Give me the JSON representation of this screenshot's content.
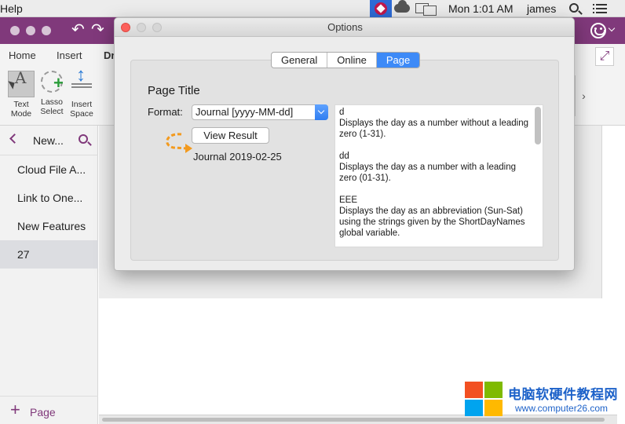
{
  "menubar": {
    "app_menu": "Help",
    "clock": "Mon 1:01 AM",
    "user": "james",
    "icons": [
      "gem-icon",
      "cloud-icon",
      "screen-mirroring-icon",
      "spotlight-icon",
      "list-icon"
    ]
  },
  "window": {
    "titlebar_color": "#80397b",
    "ribbon_tabs": [
      "Home",
      "Insert",
      "Dr"
    ],
    "tools": [
      {
        "label": "Text\nMode",
        "icon": "text-mode-icon"
      },
      {
        "label": "Lasso\nSelect",
        "icon": "lasso-select-icon"
      },
      {
        "label": "Insert\nSpace",
        "icon": "insert-space-icon"
      }
    ]
  },
  "nav": {
    "section_title": "New...",
    "pages": [
      "Cloud File A...",
      "Link to One...",
      "New Features",
      "27"
    ],
    "selected_index": 3,
    "add_page_label": "Page"
  },
  "dialog": {
    "title": "Options",
    "tabs": [
      "General",
      "Online",
      "Page"
    ],
    "active_tab": "Page",
    "section_title": "Page Title",
    "format_label": "Format:",
    "format_value": "Journal [yyyy-MM-dd]",
    "view_result_label": "View Result",
    "result_text": "Journal 2019-02-25",
    "help_entries": [
      {
        "token": "d",
        "description": "Displays the day as a number without a leading zero (1-31)."
      },
      {
        "token": "dd",
        "description": "Displays the day as a number with a leading zero (01-31)."
      },
      {
        "token": "EEE",
        "description": "Displays the day as an abbreviation (Sun-Sat) using the strings given by the ShortDayNames global variable."
      }
    ],
    "accent_color": "#3d8af7",
    "annotation_color": "#f39a1e"
  },
  "watermark": {
    "chinese": "电脑软硬件教程网",
    "url": "www.computer26.com"
  }
}
